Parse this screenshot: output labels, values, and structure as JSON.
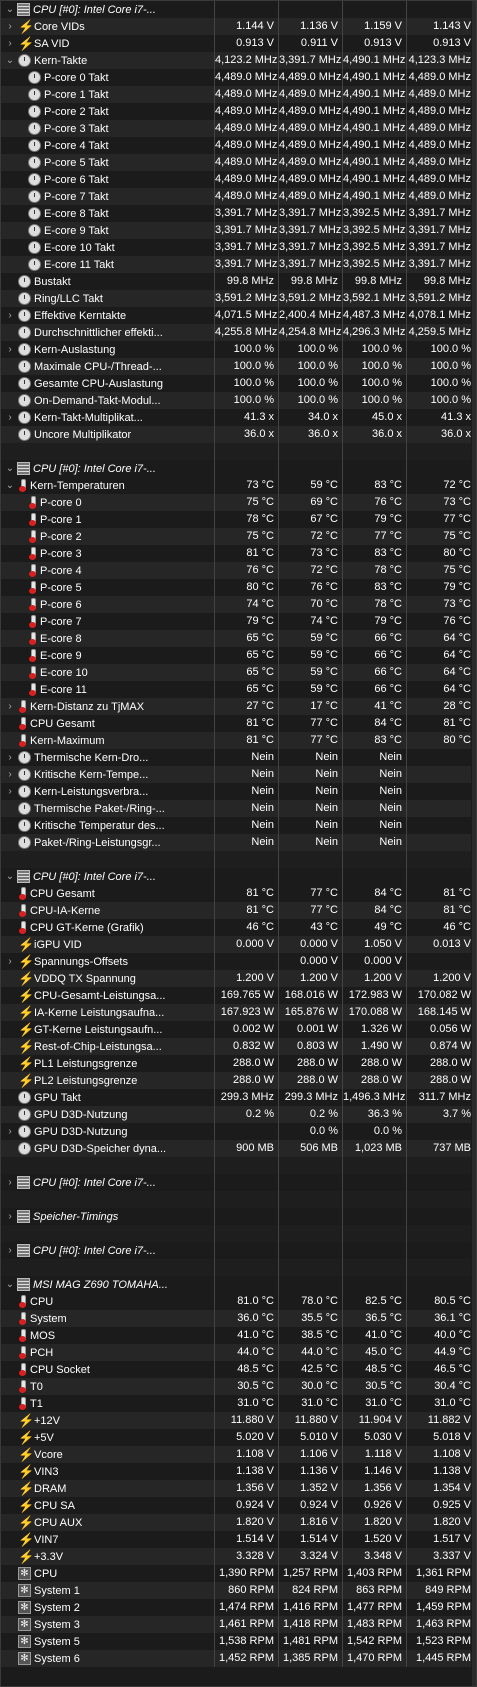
{
  "rows": [
    {
      "type": "section",
      "exp": "v",
      "icon": "chip",
      "name": "CPU [#0]: Intel Core i7-...",
      "v": [
        "",
        "",
        "",
        ""
      ]
    },
    {
      "exp": ">",
      "indent": 1,
      "icon": "volt",
      "name": "Core VIDs",
      "v": [
        "1.144 V",
        "1.136 V",
        "1.159 V",
        "1.143 V"
      ]
    },
    {
      "exp": ">",
      "indent": 0,
      "icon": "volt",
      "name": "SA VID",
      "v": [
        "0.913 V",
        "0.911 V",
        "0.913 V",
        "0.913 V"
      ]
    },
    {
      "exp": "v",
      "indent": 1,
      "icon": "clock",
      "name": "Kern-Takte",
      "v": [
        "4,123.2 MHz",
        "3,391.7 MHz",
        "4,490.1 MHz",
        "4,123.3 MHz"
      ]
    },
    {
      "indent": 2,
      "icon": "clock",
      "name": "P-core 0 Takt",
      "v": [
        "4,489.0 MHz",
        "4,489.0 MHz",
        "4,490.1 MHz",
        "4,489.0 MHz"
      ]
    },
    {
      "indent": 2,
      "icon": "clock",
      "name": "P-core 1 Takt",
      "v": [
        "4,489.0 MHz",
        "4,489.0 MHz",
        "4,490.1 MHz",
        "4,489.0 MHz"
      ]
    },
    {
      "indent": 2,
      "icon": "clock",
      "name": "P-core 2 Takt",
      "v": [
        "4,489.0 MHz",
        "4,489.0 MHz",
        "4,490.1 MHz",
        "4,489.0 MHz"
      ]
    },
    {
      "indent": 2,
      "icon": "clock",
      "name": "P-core 3 Takt",
      "v": [
        "4,489.0 MHz",
        "4,489.0 MHz",
        "4,490.1 MHz",
        "4,489.0 MHz"
      ]
    },
    {
      "indent": 2,
      "icon": "clock",
      "name": "P-core 4 Takt",
      "v": [
        "4,489.0 MHz",
        "4,489.0 MHz",
        "4,490.1 MHz",
        "4,489.0 MHz"
      ]
    },
    {
      "indent": 2,
      "icon": "clock",
      "name": "P-core 5 Takt",
      "v": [
        "4,489.0 MHz",
        "4,489.0 MHz",
        "4,490.1 MHz",
        "4,489.0 MHz"
      ]
    },
    {
      "indent": 2,
      "icon": "clock",
      "name": "P-core 6 Takt",
      "v": [
        "4,489.0 MHz",
        "4,489.0 MHz",
        "4,490.1 MHz",
        "4,489.0 MHz"
      ]
    },
    {
      "indent": 2,
      "icon": "clock",
      "name": "P-core 7 Takt",
      "v": [
        "4,489.0 MHz",
        "4,489.0 MHz",
        "4,490.1 MHz",
        "4,489.0 MHz"
      ]
    },
    {
      "indent": 2,
      "icon": "clock",
      "name": "E-core 8 Takt",
      "v": [
        "3,391.7 MHz",
        "3,391.7 MHz",
        "3,392.5 MHz",
        "3,391.7 MHz"
      ]
    },
    {
      "indent": 2,
      "icon": "clock",
      "name": "E-core 9 Takt",
      "v": [
        "3,391.7 MHz",
        "3,391.7 MHz",
        "3,392.5 MHz",
        "3,391.7 MHz"
      ]
    },
    {
      "indent": 2,
      "icon": "clock",
      "name": "E-core 10 Takt",
      "v": [
        "3,391.7 MHz",
        "3,391.7 MHz",
        "3,392.5 MHz",
        "3,391.7 MHz"
      ]
    },
    {
      "indent": 2,
      "icon": "clock",
      "name": "E-core 11 Takt",
      "v": [
        "3,391.7 MHz",
        "3,391.7 MHz",
        "3,392.5 MHz",
        "3,391.7 MHz"
      ]
    },
    {
      "indent": 0,
      "icon": "clock",
      "name": "Bustakt",
      "v": [
        "99.8 MHz",
        "99.8 MHz",
        "99.8 MHz",
        "99.8 MHz"
      ]
    },
    {
      "indent": 0,
      "icon": "clock",
      "name": "Ring/LLC Takt",
      "v": [
        "3,591.2 MHz",
        "3,591.2 MHz",
        "3,592.1 MHz",
        "3,591.2 MHz"
      ]
    },
    {
      "exp": ">",
      "indent": 1,
      "icon": "clock",
      "name": "Effektive Kerntakte",
      "v": [
        "4,071.5 MHz",
        "2,400.4 MHz",
        "4,487.3 MHz",
        "4,078.1 MHz"
      ]
    },
    {
      "indent": 0,
      "icon": "clock",
      "name": "Durchschnittlicher effekti...",
      "v": [
        "4,255.8 MHz",
        "4,254.8 MHz",
        "4,296.3 MHz",
        "4,259.5 MHz"
      ]
    },
    {
      "exp": ">",
      "indent": 1,
      "icon": "clock",
      "name": "Kern-Auslastung",
      "v": [
        "100.0 %",
        "100.0 %",
        "100.0 %",
        "100.0 %"
      ]
    },
    {
      "indent": 0,
      "icon": "clock",
      "name": "Maximale CPU-/Thread-...",
      "v": [
        "100.0 %",
        "100.0 %",
        "100.0 %",
        "100.0 %"
      ]
    },
    {
      "indent": 0,
      "icon": "clock",
      "name": "Gesamte CPU-Auslastung",
      "v": [
        "100.0 %",
        "100.0 %",
        "100.0 %",
        "100.0 %"
      ]
    },
    {
      "indent": 0,
      "icon": "clock",
      "name": "On-Demand-Takt-Modul...",
      "v": [
        "100.0 %",
        "100.0 %",
        "100.0 %",
        "100.0 %"
      ]
    },
    {
      "exp": ">",
      "indent": 1,
      "icon": "clock",
      "name": "Kern-Takt-Multiplikat...",
      "v": [
        "41.3 x",
        "34.0 x",
        "45.0 x",
        "41.3 x"
      ]
    },
    {
      "indent": 0,
      "icon": "clock",
      "name": "Uncore Multiplikator",
      "v": [
        "36.0 x",
        "36.0 x",
        "36.0 x",
        "36.0 x"
      ]
    },
    {
      "type": "empty",
      "v": [
        "",
        "",
        "",
        ""
      ]
    },
    {
      "type": "section",
      "exp": "v",
      "icon": "chip",
      "name": "CPU [#0]: Intel Core i7-...",
      "v": [
        "",
        "",
        "",
        ""
      ]
    },
    {
      "exp": "v",
      "indent": 1,
      "icon": "temp",
      "name": "Kern-Temperaturen",
      "v": [
        "73 °C",
        "59 °C",
        "83 °C",
        "72 °C"
      ]
    },
    {
      "indent": 2,
      "icon": "temp",
      "name": "P-core 0",
      "v": [
        "75 °C",
        "69 °C",
        "76 °C",
        "73 °C"
      ]
    },
    {
      "indent": 2,
      "icon": "temp",
      "name": "P-core 1",
      "v": [
        "78 °C",
        "67 °C",
        "79 °C",
        "77 °C"
      ]
    },
    {
      "indent": 2,
      "icon": "temp",
      "name": "P-core 2",
      "v": [
        "75 °C",
        "72 °C",
        "77 °C",
        "75 °C"
      ]
    },
    {
      "indent": 2,
      "icon": "temp",
      "name": "P-core 3",
      "v": [
        "81 °C",
        "73 °C",
        "83 °C",
        "80 °C"
      ]
    },
    {
      "indent": 2,
      "icon": "temp",
      "name": "P-core 4",
      "v": [
        "76 °C",
        "72 °C",
        "78 °C",
        "75 °C"
      ]
    },
    {
      "indent": 2,
      "icon": "temp",
      "name": "P-core 5",
      "v": [
        "80 °C",
        "76 °C",
        "83 °C",
        "79 °C"
      ]
    },
    {
      "indent": 2,
      "icon": "temp",
      "name": "P-core 6",
      "v": [
        "74 °C",
        "70 °C",
        "78 °C",
        "73 °C"
      ]
    },
    {
      "indent": 2,
      "icon": "temp",
      "name": "P-core 7",
      "v": [
        "79 °C",
        "74 °C",
        "79 °C",
        "76 °C"
      ]
    },
    {
      "indent": 2,
      "icon": "temp",
      "name": "E-core 8",
      "v": [
        "65 °C",
        "59 °C",
        "66 °C",
        "64 °C"
      ]
    },
    {
      "indent": 2,
      "icon": "temp",
      "name": "E-core 9",
      "v": [
        "65 °C",
        "59 °C",
        "66 °C",
        "64 °C"
      ]
    },
    {
      "indent": 2,
      "icon": "temp",
      "name": "E-core 10",
      "v": [
        "65 °C",
        "59 °C",
        "66 °C",
        "64 °C"
      ]
    },
    {
      "indent": 2,
      "icon": "temp",
      "name": "E-core 11",
      "v": [
        "65 °C",
        "59 °C",
        "66 °C",
        "64 °C"
      ]
    },
    {
      "exp": ">",
      "indent": 1,
      "icon": "temp",
      "name": "Kern-Distanz zu TjMAX",
      "v": [
        "27 °C",
        "17 °C",
        "41 °C",
        "28 °C"
      ]
    },
    {
      "indent": 0,
      "icon": "temp",
      "name": "CPU Gesamt",
      "v": [
        "81 °C",
        "77 °C",
        "84 °C",
        "81 °C"
      ]
    },
    {
      "indent": 0,
      "icon": "temp",
      "name": "Kern-Maximum",
      "v": [
        "81 °C",
        "77 °C",
        "83 °C",
        "80 °C"
      ]
    },
    {
      "exp": ">",
      "indent": 1,
      "icon": "clock",
      "name": "Thermische Kern-Dro...",
      "v": [
        "Nein",
        "Nein",
        "Nein",
        ""
      ]
    },
    {
      "exp": ">",
      "indent": 1,
      "icon": "clock",
      "name": "Kritische Kern-Tempe...",
      "v": [
        "Nein",
        "Nein",
        "Nein",
        ""
      ]
    },
    {
      "exp": ">",
      "indent": 1,
      "icon": "clock",
      "name": "Kern-Leistungsverbra...",
      "v": [
        "Nein",
        "Nein",
        "Nein",
        ""
      ]
    },
    {
      "indent": 0,
      "icon": "clock",
      "name": "Thermische Paket-/Ring-...",
      "v": [
        "Nein",
        "Nein",
        "Nein",
        ""
      ]
    },
    {
      "indent": 0,
      "icon": "clock",
      "name": "Kritische Temperatur des...",
      "v": [
        "Nein",
        "Nein",
        "Nein",
        ""
      ]
    },
    {
      "indent": 0,
      "icon": "clock",
      "name": "Paket-/Ring-Leistungsgr...",
      "v": [
        "Nein",
        "Nein",
        "Nein",
        ""
      ]
    },
    {
      "type": "empty",
      "v": [
        "",
        "",
        "",
        ""
      ]
    },
    {
      "type": "section",
      "exp": "v",
      "icon": "chip",
      "name": "CPU [#0]: Intel Core i7-...",
      "v": [
        "",
        "",
        "",
        ""
      ]
    },
    {
      "indent": 0,
      "icon": "temp",
      "name": "CPU Gesamt",
      "v": [
        "81 °C",
        "77 °C",
        "84 °C",
        "81 °C"
      ]
    },
    {
      "indent": 0,
      "icon": "temp",
      "name": "CPU-IA-Kerne",
      "v": [
        "81 °C",
        "77 °C",
        "84 °C",
        "81 °C"
      ]
    },
    {
      "indent": 0,
      "icon": "temp",
      "name": "CPU GT-Kerne (Grafik)",
      "v": [
        "46 °C",
        "43 °C",
        "49 °C",
        "46 °C"
      ]
    },
    {
      "indent": 0,
      "icon": "volt",
      "name": "iGPU VID",
      "v": [
        "0.000 V",
        "0.000 V",
        "1.050 V",
        "0.013 V"
      ]
    },
    {
      "exp": ">",
      "indent": 1,
      "icon": "volt",
      "name": "Spannungs-Offsets",
      "v": [
        "",
        "0.000 V",
        "0.000 V",
        ""
      ]
    },
    {
      "indent": 0,
      "icon": "volt",
      "name": "VDDQ TX Spannung",
      "v": [
        "1.200 V",
        "1.200 V",
        "1.200 V",
        "1.200 V"
      ]
    },
    {
      "indent": 0,
      "icon": "volt",
      "name": "CPU-Gesamt-Leistungsa...",
      "v": [
        "169.765 W",
        "168.016 W",
        "172.983 W",
        "170.082 W"
      ]
    },
    {
      "indent": 0,
      "icon": "volt",
      "name": "IA-Kerne Leistungsaufna...",
      "v": [
        "167.923 W",
        "165.876 W",
        "170.088 W",
        "168.145 W"
      ]
    },
    {
      "indent": 0,
      "icon": "volt",
      "name": "GT-Kerne Leistungsaufn...",
      "v": [
        "0.002 W",
        "0.001 W",
        "1.326 W",
        "0.056 W"
      ]
    },
    {
      "indent": 0,
      "icon": "volt",
      "name": "Rest-of-Chip-Leistungsa...",
      "v": [
        "0.832 W",
        "0.803 W",
        "1.490 W",
        "0.874 W"
      ]
    },
    {
      "indent": 0,
      "icon": "volt",
      "name": "PL1 Leistungsgrenze",
      "v": [
        "288.0 W",
        "288.0 W",
        "288.0 W",
        "288.0 W"
      ]
    },
    {
      "indent": 0,
      "icon": "volt",
      "name": "PL2 Leistungsgrenze",
      "v": [
        "288.0 W",
        "288.0 W",
        "288.0 W",
        "288.0 W"
      ]
    },
    {
      "indent": 0,
      "icon": "clock",
      "name": "GPU Takt",
      "v": [
        "299.3 MHz",
        "299.3 MHz",
        "1,496.3 MHz",
        "311.7 MHz"
      ]
    },
    {
      "indent": 0,
      "icon": "clock",
      "name": "GPU D3D-Nutzung",
      "v": [
        "0.2 %",
        "0.2 %",
        "36.3 %",
        "3.7 %"
      ]
    },
    {
      "exp": ">",
      "indent": 1,
      "icon": "clock",
      "name": "GPU D3D-Nutzung",
      "v": [
        "",
        "0.0 %",
        "0.0 %",
        ""
      ]
    },
    {
      "indent": 0,
      "icon": "clock",
      "name": "GPU D3D-Speicher dyna...",
      "v": [
        "900 MB",
        "506 MB",
        "1,023 MB",
        "737 MB"
      ]
    },
    {
      "type": "empty",
      "v": [
        "",
        "",
        "",
        ""
      ]
    },
    {
      "type": "section",
      "exp": ">",
      "icon": "chip",
      "name": "CPU [#0]: Intel Core i7-...",
      "v": [
        "",
        "",
        "",
        ""
      ]
    },
    {
      "type": "empty",
      "v": [
        "",
        "",
        "",
        ""
      ]
    },
    {
      "type": "section",
      "exp": ">",
      "icon": "chip",
      "name": "Speicher-Timings",
      "v": [
        "",
        "",
        "",
        ""
      ]
    },
    {
      "type": "empty",
      "v": [
        "",
        "",
        "",
        ""
      ]
    },
    {
      "type": "section",
      "exp": ">",
      "icon": "chip",
      "name": "CPU [#0]: Intel Core i7-...",
      "v": [
        "",
        "",
        "",
        ""
      ]
    },
    {
      "type": "empty",
      "v": [
        "",
        "",
        "",
        ""
      ]
    },
    {
      "type": "section",
      "exp": "v",
      "icon": "chip",
      "name": "MSI MAG Z690 TOMAHA...",
      "v": [
        "",
        "",
        "",
        ""
      ]
    },
    {
      "indent": 0,
      "icon": "temp",
      "name": "CPU",
      "v": [
        "81.0 °C",
        "78.0 °C",
        "82.5 °C",
        "80.5 °C"
      ]
    },
    {
      "indent": 0,
      "icon": "temp",
      "name": "System",
      "v": [
        "36.0 °C",
        "35.5 °C",
        "36.5 °C",
        "36.1 °C"
      ]
    },
    {
      "indent": 0,
      "icon": "temp",
      "name": "MOS",
      "v": [
        "41.0 °C",
        "38.5 °C",
        "41.0 °C",
        "40.0 °C"
      ]
    },
    {
      "indent": 0,
      "icon": "temp",
      "name": "PCH",
      "v": [
        "44.0 °C",
        "44.0 °C",
        "45.0 °C",
        "44.9 °C"
      ]
    },
    {
      "indent": 0,
      "icon": "temp",
      "name": "CPU Socket",
      "v": [
        "48.5 °C",
        "42.5 °C",
        "48.5 °C",
        "46.5 °C"
      ]
    },
    {
      "indent": 0,
      "icon": "temp",
      "name": "T0",
      "v": [
        "30.5 °C",
        "30.0 °C",
        "30.5 °C",
        "30.4 °C"
      ]
    },
    {
      "indent": 0,
      "icon": "temp",
      "name": "T1",
      "v": [
        "31.0 °C",
        "31.0 °C",
        "31.0 °C",
        "31.0 °C"
      ]
    },
    {
      "indent": 0,
      "icon": "volt",
      "name": "+12V",
      "v": [
        "11.880 V",
        "11.880 V",
        "11.904 V",
        "11.882 V"
      ]
    },
    {
      "indent": 0,
      "icon": "volt",
      "name": "+5V",
      "v": [
        "5.020 V",
        "5.010 V",
        "5.030 V",
        "5.018 V"
      ]
    },
    {
      "indent": 0,
      "icon": "volt",
      "name": "Vcore",
      "v": [
        "1.108 V",
        "1.106 V",
        "1.118 V",
        "1.108 V"
      ]
    },
    {
      "indent": 0,
      "icon": "volt",
      "name": "VIN3",
      "v": [
        "1.138 V",
        "1.136 V",
        "1.146 V",
        "1.138 V"
      ]
    },
    {
      "indent": 0,
      "icon": "volt",
      "name": "DRAM",
      "v": [
        "1.356 V",
        "1.352 V",
        "1.356 V",
        "1.354 V"
      ]
    },
    {
      "indent": 0,
      "icon": "volt",
      "name": "CPU SA",
      "v": [
        "0.924 V",
        "0.924 V",
        "0.926 V",
        "0.925 V"
      ]
    },
    {
      "indent": 0,
      "icon": "volt",
      "name": "CPU AUX",
      "v": [
        "1.820 V",
        "1.816 V",
        "1.820 V",
        "1.820 V"
      ]
    },
    {
      "indent": 0,
      "icon": "volt",
      "name": "VIN7",
      "v": [
        "1.514 V",
        "1.514 V",
        "1.520 V",
        "1.517 V"
      ]
    },
    {
      "indent": 0,
      "icon": "volt",
      "name": "+3.3V",
      "v": [
        "3.328 V",
        "3.324 V",
        "3.348 V",
        "3.337 V"
      ]
    },
    {
      "indent": 0,
      "icon": "fan",
      "name": "CPU",
      "v": [
        "1,390 RPM",
        "1,257 RPM",
        "1,403 RPM",
        "1,361 RPM"
      ]
    },
    {
      "indent": 0,
      "icon": "fan",
      "name": "System 1",
      "v": [
        "860 RPM",
        "824 RPM",
        "863 RPM",
        "849 RPM"
      ]
    },
    {
      "indent": 0,
      "icon": "fan",
      "name": "System 2",
      "v": [
        "1,474 RPM",
        "1,416 RPM",
        "1,477 RPM",
        "1,459 RPM"
      ]
    },
    {
      "indent": 0,
      "icon": "fan",
      "name": "System 3",
      "v": [
        "1,461 RPM",
        "1,418 RPM",
        "1,483 RPM",
        "1,463 RPM"
      ]
    },
    {
      "indent": 0,
      "icon": "fan",
      "name": "System 5",
      "v": [
        "1,538 RPM",
        "1,481 RPM",
        "1,542 RPM",
        "1,523 RPM"
      ]
    },
    {
      "indent": 0,
      "icon": "fan",
      "name": "System 6",
      "v": [
        "1,452 RPM",
        "1,385 RPM",
        "1,470 RPM",
        "1,445 RPM"
      ]
    }
  ]
}
